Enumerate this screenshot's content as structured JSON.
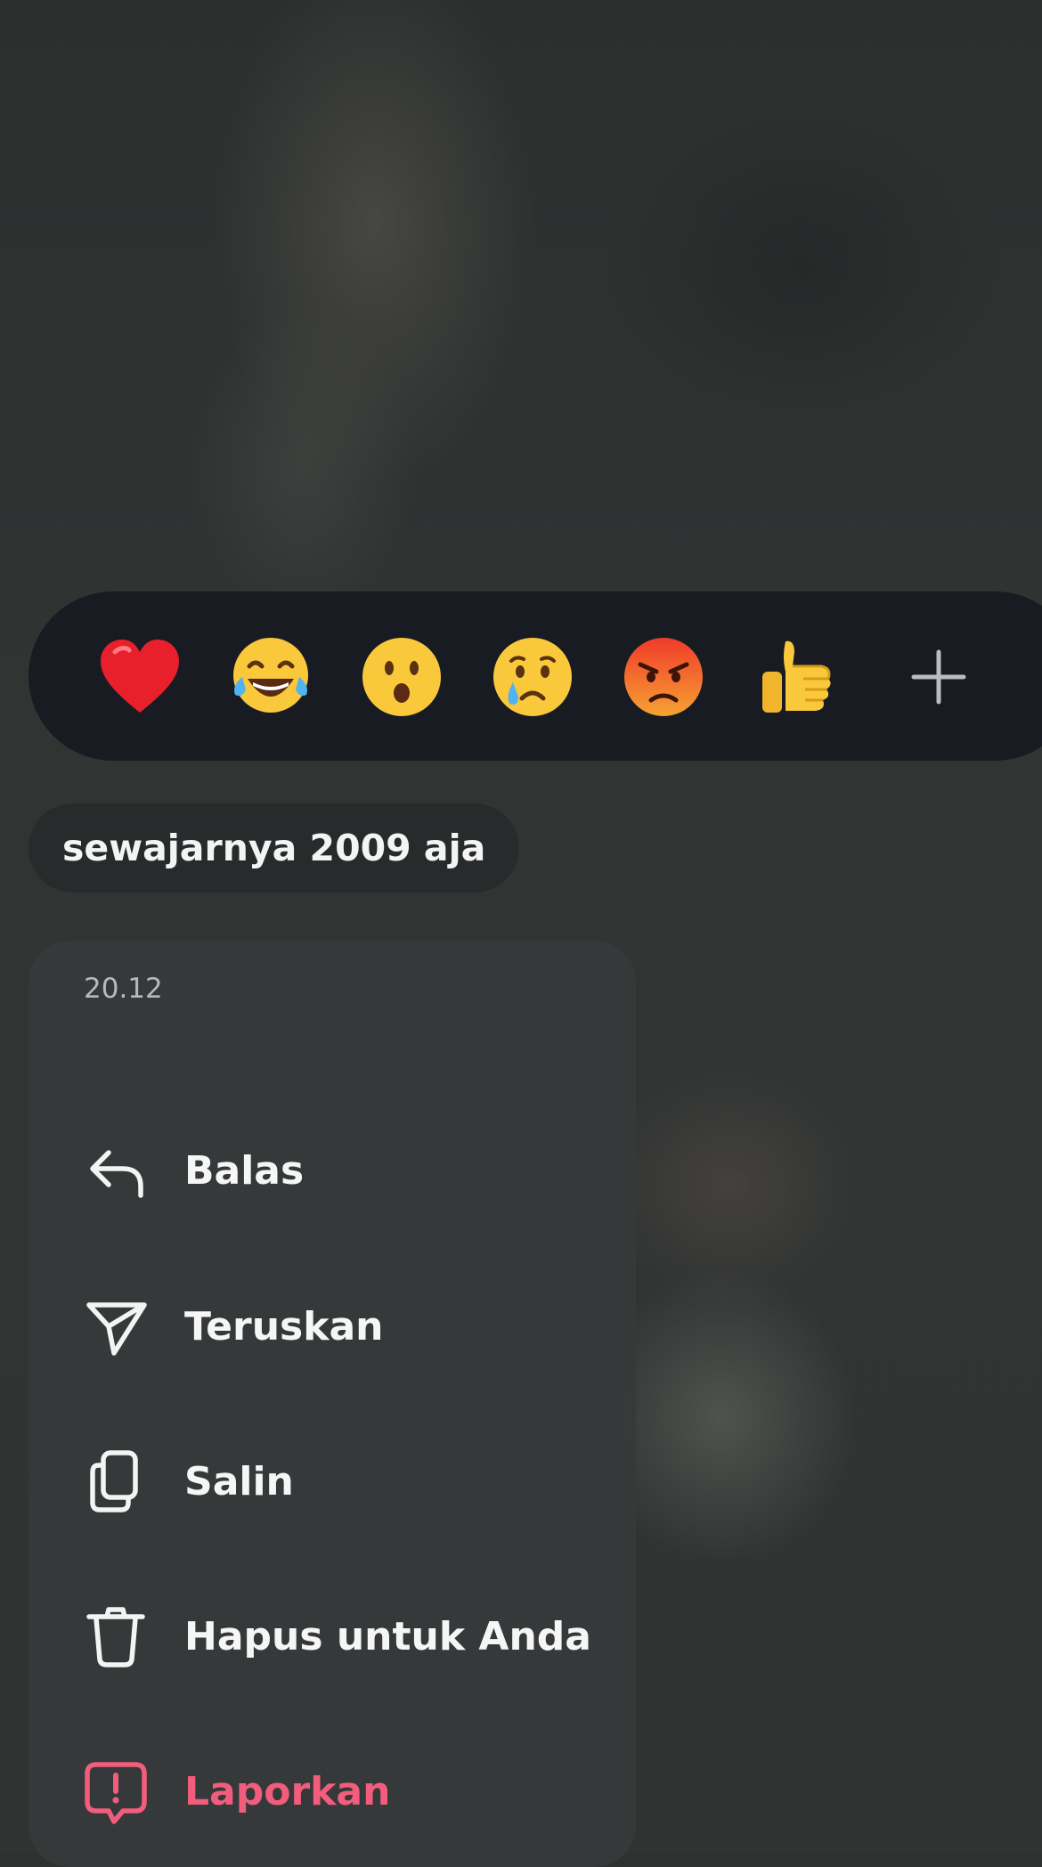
{
  "reactions": {
    "emojis": [
      {
        "icon": "red-heart-emoji"
      },
      {
        "icon": "tears-of-joy-emoji"
      },
      {
        "icon": "surprised-face-emoji"
      },
      {
        "icon": "crying-face-emoji"
      },
      {
        "icon": "angry-face-emoji"
      },
      {
        "icon": "thumbs-up-emoji"
      }
    ],
    "more_icon": "plus-icon"
  },
  "message": {
    "text": "sewajarnya 2009 aja"
  },
  "menu": {
    "timestamp": "20.12",
    "items": [
      {
        "label": "Balas",
        "icon": "reply-icon"
      },
      {
        "label": "Teruskan",
        "icon": "send-icon"
      },
      {
        "label": "Salin",
        "icon": "copy-icon"
      },
      {
        "label": "Hapus untuk Anda",
        "icon": "trash-icon"
      },
      {
        "label": "Laporkan",
        "icon": "report-icon",
        "color": "#f25d7e"
      }
    ]
  }
}
